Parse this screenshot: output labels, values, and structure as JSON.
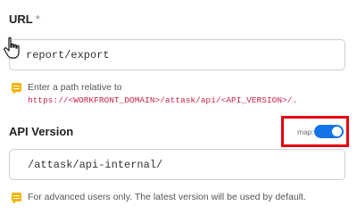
{
  "url_section": {
    "label": "URL",
    "required_mark": "*",
    "value": "report/export",
    "hint_prefix": "Enter a path relative to",
    "hint_code": "https://<WORKFRONT_DOMAIN>/attask/api/<API_VERSION>/."
  },
  "api_version_section": {
    "label": "API Version",
    "map_label": "map:",
    "map_toggle_on": true,
    "value": "/attask/api-internal/",
    "hint": "For advanced users only. The latest version will be used by default."
  },
  "colors": {
    "toggle_on": "#1473e6",
    "highlight_border": "#e3000f",
    "hint_icon": "#f2b500",
    "code_text": "#c7254e"
  }
}
